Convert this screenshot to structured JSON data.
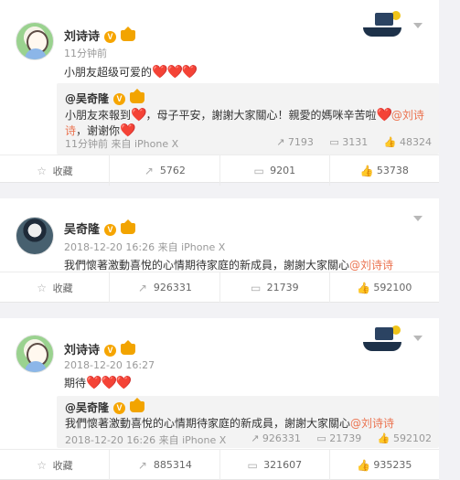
{
  "posts": [
    {
      "author": "刘诗诗",
      "time": "11分钟前",
      "content_text": "小朋友超级可爱的",
      "content_hearts": "❤️❤️❤️",
      "repost": {
        "author": "@吴奇隆",
        "line1_prefix": "小朋友來報到",
        "line1_middle": "，母子平安，謝謝大家關心！親愛的媽咪辛苦啦",
        "line1_mention": "@刘诗",
        "line2_mention": "诗",
        "line2_suffix": "，谢谢你",
        "meta": "11分钟前 来自 iPhone X",
        "stats": [
          "7193",
          "3131",
          "48324"
        ]
      },
      "actions": [
        "收藏",
        "5762",
        "9201",
        "53738"
      ]
    },
    {
      "author": "吴奇隆",
      "time": "2018-12-20 16:26 来自 iPhone X",
      "content_text": "我們懷著激動喜悅的心情期待家庭的新成員，謝謝大家關心",
      "content_mention": "@刘诗诗",
      "actions": [
        "收藏",
        "926331",
        "21739",
        "592100"
      ]
    },
    {
      "author": "刘诗诗",
      "time": "2018-12-20 16:27",
      "content_text": "期待",
      "content_hearts": "❤️❤️❤️",
      "repost": {
        "author": "@吴奇隆",
        "line1_prefix": "我們懷著激動喜悅的心情期待家庭的新成員，謝謝大家關心",
        "line1_mention": "@刘诗诗",
        "meta": "2018-12-20 16:26 来自 iPhone X",
        "stats": [
          "926331",
          "21739",
          "592102"
        ]
      },
      "actions": [
        "收藏",
        "885314",
        "321607",
        "935235"
      ]
    }
  ]
}
